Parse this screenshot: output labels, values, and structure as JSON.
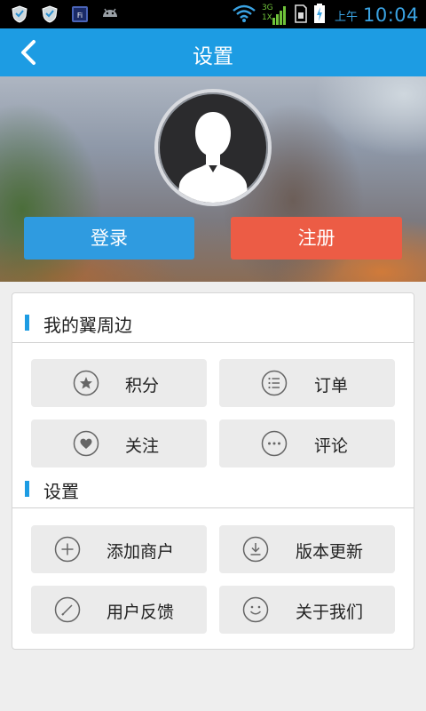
{
  "status_bar": {
    "icons": [
      "shield-icon",
      "shield-icon",
      "wifi-notification-icon",
      "android-icon"
    ],
    "right_icons": [
      "wifi-signal-icon",
      "3g-signal-icon",
      "sim-card-icon",
      "battery-icon"
    ],
    "network_label_top": "3G",
    "network_label_bottom": "1X",
    "ampm": "上午",
    "time": "10:04"
  },
  "titlebar": {
    "title": "设置",
    "back_icon": "chevron-left-icon"
  },
  "header": {
    "avatar_icon": "user-silhouette-icon",
    "login_label": "登录",
    "register_label": "注册"
  },
  "sections": [
    {
      "title": "我的翼周边",
      "items": [
        {
          "label": "积分",
          "icon": "star-circle-icon"
        },
        {
          "label": "订单",
          "icon": "list-circle-icon"
        },
        {
          "label": "关注",
          "icon": "heart-circle-icon"
        },
        {
          "label": "评论",
          "icon": "ellipsis-circle-icon"
        }
      ]
    },
    {
      "title": "设置",
      "items": [
        {
          "label": "添加商户",
          "icon": "plus-circle-icon"
        },
        {
          "label": "版本更新",
          "icon": "download-circle-icon"
        },
        {
          "label": "用户反馈",
          "icon": "pencil-circle-icon"
        },
        {
          "label": "关于我们",
          "icon": "smiley-circle-icon"
        }
      ]
    }
  ],
  "colors": {
    "primary": "#1d9ce3",
    "login": "#2f9be0",
    "register": "#ec5c45",
    "background": "#eeeeee",
    "tile": "#ebebeb"
  }
}
